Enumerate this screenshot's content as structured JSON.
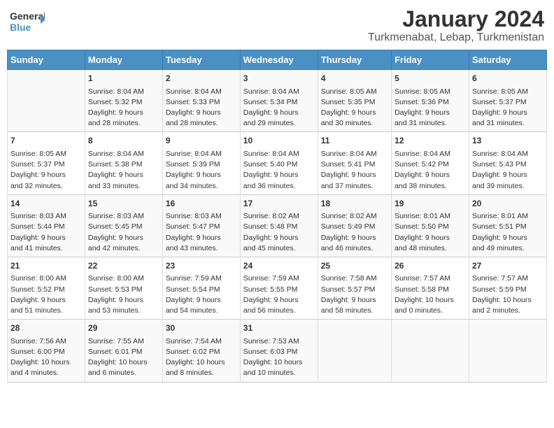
{
  "logo": {
    "line1": "General",
    "line2": "Blue"
  },
  "title": "January 2024",
  "subtitle": "Turkmenabat, Lebap, Turkmenistan",
  "days_of_week": [
    "Sunday",
    "Monday",
    "Tuesday",
    "Wednesday",
    "Thursday",
    "Friday",
    "Saturday"
  ],
  "weeks": [
    [
      {
        "num": "",
        "info": ""
      },
      {
        "num": "1",
        "info": "Sunrise: 8:04 AM\nSunset: 5:32 PM\nDaylight: 9 hours\nand 28 minutes."
      },
      {
        "num": "2",
        "info": "Sunrise: 8:04 AM\nSunset: 5:33 PM\nDaylight: 9 hours\nand 28 minutes."
      },
      {
        "num": "3",
        "info": "Sunrise: 8:04 AM\nSunset: 5:34 PM\nDaylight: 9 hours\nand 29 minutes."
      },
      {
        "num": "4",
        "info": "Sunrise: 8:05 AM\nSunset: 5:35 PM\nDaylight: 9 hours\nand 30 minutes."
      },
      {
        "num": "5",
        "info": "Sunrise: 8:05 AM\nSunset: 5:36 PM\nDaylight: 9 hours\nand 31 minutes."
      },
      {
        "num": "6",
        "info": "Sunrise: 8:05 AM\nSunset: 5:37 PM\nDaylight: 9 hours\nand 31 minutes."
      }
    ],
    [
      {
        "num": "7",
        "info": "Sunrise: 8:05 AM\nSunset: 5:37 PM\nDaylight: 9 hours\nand 32 minutes."
      },
      {
        "num": "8",
        "info": "Sunrise: 8:04 AM\nSunset: 5:38 PM\nDaylight: 9 hours\nand 33 minutes."
      },
      {
        "num": "9",
        "info": "Sunrise: 8:04 AM\nSunset: 5:39 PM\nDaylight: 9 hours\nand 34 minutes."
      },
      {
        "num": "10",
        "info": "Sunrise: 8:04 AM\nSunset: 5:40 PM\nDaylight: 9 hours\nand 36 minutes."
      },
      {
        "num": "11",
        "info": "Sunrise: 8:04 AM\nSunset: 5:41 PM\nDaylight: 9 hours\nand 37 minutes."
      },
      {
        "num": "12",
        "info": "Sunrise: 8:04 AM\nSunset: 5:42 PM\nDaylight: 9 hours\nand 38 minutes."
      },
      {
        "num": "13",
        "info": "Sunrise: 8:04 AM\nSunset: 5:43 PM\nDaylight: 9 hours\nand 39 minutes."
      }
    ],
    [
      {
        "num": "14",
        "info": "Sunrise: 8:03 AM\nSunset: 5:44 PM\nDaylight: 9 hours\nand 41 minutes."
      },
      {
        "num": "15",
        "info": "Sunrise: 8:03 AM\nSunset: 5:45 PM\nDaylight: 9 hours\nand 42 minutes."
      },
      {
        "num": "16",
        "info": "Sunrise: 8:03 AM\nSunset: 5:47 PM\nDaylight: 9 hours\nand 43 minutes."
      },
      {
        "num": "17",
        "info": "Sunrise: 8:02 AM\nSunset: 5:48 PM\nDaylight: 9 hours\nand 45 minutes."
      },
      {
        "num": "18",
        "info": "Sunrise: 8:02 AM\nSunset: 5:49 PM\nDaylight: 9 hours\nand 46 minutes."
      },
      {
        "num": "19",
        "info": "Sunrise: 8:01 AM\nSunset: 5:50 PM\nDaylight: 9 hours\nand 48 minutes."
      },
      {
        "num": "20",
        "info": "Sunrise: 8:01 AM\nSunset: 5:51 PM\nDaylight: 9 hours\nand 49 minutes."
      }
    ],
    [
      {
        "num": "21",
        "info": "Sunrise: 8:00 AM\nSunset: 5:52 PM\nDaylight: 9 hours\nand 51 minutes."
      },
      {
        "num": "22",
        "info": "Sunrise: 8:00 AM\nSunset: 5:53 PM\nDaylight: 9 hours\nand 53 minutes."
      },
      {
        "num": "23",
        "info": "Sunrise: 7:59 AM\nSunset: 5:54 PM\nDaylight: 9 hours\nand 54 minutes."
      },
      {
        "num": "24",
        "info": "Sunrise: 7:59 AM\nSunset: 5:55 PM\nDaylight: 9 hours\nand 56 minutes."
      },
      {
        "num": "25",
        "info": "Sunrise: 7:58 AM\nSunset: 5:57 PM\nDaylight: 9 hours\nand 58 minutes."
      },
      {
        "num": "26",
        "info": "Sunrise: 7:57 AM\nSunset: 5:58 PM\nDaylight: 10 hours\nand 0 minutes."
      },
      {
        "num": "27",
        "info": "Sunrise: 7:57 AM\nSunset: 5:59 PM\nDaylight: 10 hours\nand 2 minutes."
      }
    ],
    [
      {
        "num": "28",
        "info": "Sunrise: 7:56 AM\nSunset: 6:00 PM\nDaylight: 10 hours\nand 4 minutes."
      },
      {
        "num": "29",
        "info": "Sunrise: 7:55 AM\nSunset: 6:01 PM\nDaylight: 10 hours\nand 6 minutes."
      },
      {
        "num": "30",
        "info": "Sunrise: 7:54 AM\nSunset: 6:02 PM\nDaylight: 10 hours\nand 8 minutes."
      },
      {
        "num": "31",
        "info": "Sunrise: 7:53 AM\nSunset: 6:03 PM\nDaylight: 10 hours\nand 10 minutes."
      },
      {
        "num": "",
        "info": ""
      },
      {
        "num": "",
        "info": ""
      },
      {
        "num": "",
        "info": ""
      }
    ]
  ]
}
